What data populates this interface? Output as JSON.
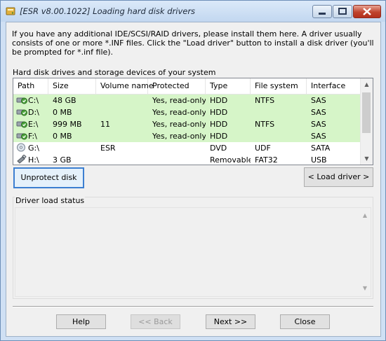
{
  "window": {
    "title": "[ESR v8.00.1022]  Loading hard disk drivers",
    "colors": {
      "protected_row": "#d6f5c8",
      "focus_border": "#3c7fd1",
      "close_button": "#c0432c"
    }
  },
  "intro_text": "If you have any additional IDE/SCSI/RAID drivers, please install them here. A driver usually consists of one or more *.INF files. Click the \"Load driver\" button to install a disk driver (you'll be prompted for *.inf file).",
  "drives_section": {
    "label": "Hard disk drives and storage devices of your system",
    "columns": [
      "Path",
      "Size",
      "Volume name",
      "Protected",
      "Type",
      "File system",
      "Interface"
    ],
    "rows": [
      {
        "path": "C:\\",
        "size": "48 GB",
        "volume": "",
        "protected": "Yes, read-only",
        "type": "HDD",
        "fs": "NTFS",
        "interface": "SAS",
        "icon": "protected-hdd-icon"
      },
      {
        "path": "D:\\",
        "size": "0 MB",
        "volume": "",
        "protected": "Yes, read-only",
        "type": "HDD",
        "fs": "",
        "interface": "SAS",
        "icon": "protected-hdd-icon"
      },
      {
        "path": "E:\\",
        "size": "999 MB",
        "volume": "11",
        "protected": "Yes, read-only",
        "type": "HDD",
        "fs": "NTFS",
        "interface": "SAS",
        "icon": "protected-hdd-icon"
      },
      {
        "path": "F:\\",
        "size": "0 MB",
        "volume": "",
        "protected": "Yes, read-only",
        "type": "HDD",
        "fs": "",
        "interface": "SAS",
        "icon": "protected-hdd-icon"
      },
      {
        "path": "G:\\",
        "size": "",
        "volume": "ESR",
        "protected": "",
        "type": "DVD",
        "fs": "UDF",
        "interface": "SATA",
        "icon": "dvd-drive-icon"
      },
      {
        "path": "H:\\",
        "size": "3 GB",
        "volume": "",
        "protected": "",
        "type": "Removable",
        "fs": "FAT32",
        "interface": "USB",
        "icon": "usb-drive-icon"
      }
    ]
  },
  "buttons": {
    "unprotect": "Unprotect disk",
    "load_driver": "< Load driver >",
    "help": "Help",
    "back": "<< Back",
    "next": "Next >>",
    "close": "Close"
  },
  "status": {
    "label": "Driver load status"
  }
}
